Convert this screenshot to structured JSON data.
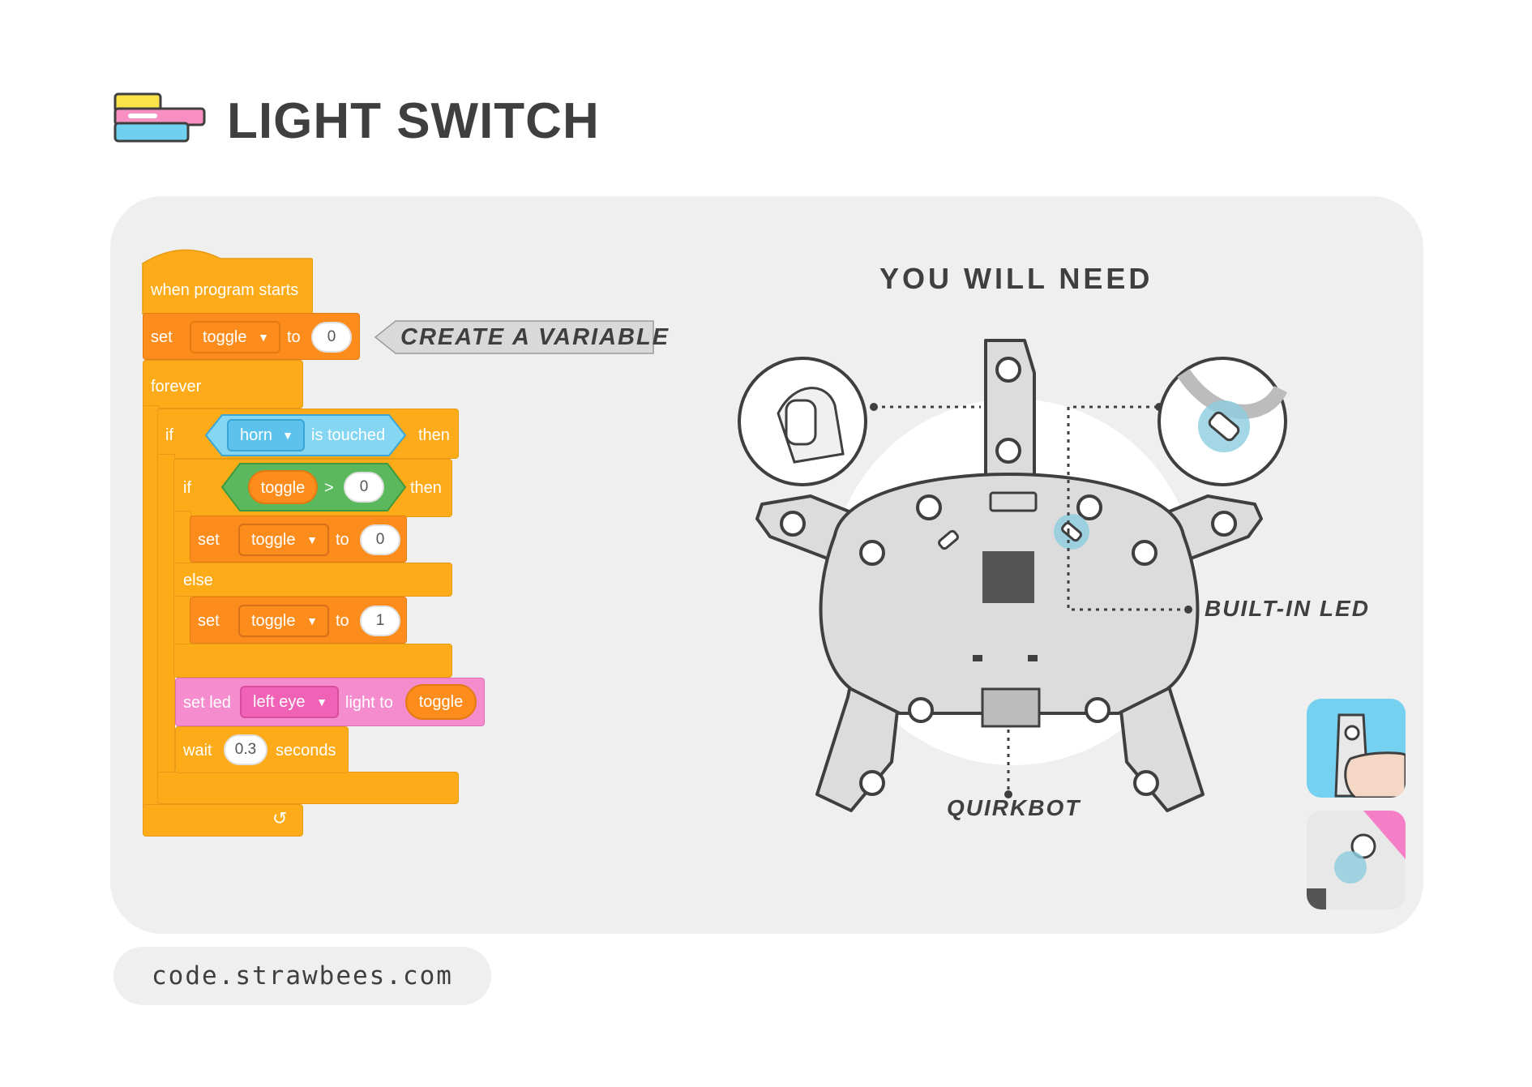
{
  "header": {
    "title": "LIGHT SWITCH",
    "logo_icon": "stacked-blocks-icon"
  },
  "code": {
    "hat": "when program starts",
    "set1": {
      "label": "set",
      "variable": "toggle",
      "to": "to",
      "value": "0"
    },
    "forever": "forever",
    "if1": {
      "if": "if",
      "sensor": "horn",
      "condition": "is touched",
      "then": "then"
    },
    "if2": {
      "if": "if",
      "variable": "toggle",
      "op": ">",
      "value": "0",
      "then": "then"
    },
    "set2": {
      "label": "set",
      "variable": "toggle",
      "to": "to",
      "value": "0"
    },
    "else": "else",
    "set3": {
      "label": "set",
      "variable": "toggle",
      "to": "to",
      "value": "1"
    },
    "setled": {
      "label": "set led",
      "led": "left eye",
      "light_to": "light to",
      "value": "toggle"
    },
    "wait": {
      "label": "wait",
      "value": "0.3",
      "unit": "seconds"
    },
    "loop_icon": "loop-arrow-icon"
  },
  "callout": {
    "create_variable": "CREATE A VARIABLE"
  },
  "need": {
    "title": "YOU WILL NEED",
    "built_in_led": "BUILT-IN LED",
    "quirkbot": "QUIRKBOT"
  },
  "footer": {
    "url": "code.strawbees.com"
  },
  "colors": {
    "panel": "#efefef",
    "events": "#fdab19",
    "variables": "#fc8d1d",
    "operators": "#5cb85c",
    "sensing": "#5ec3ec",
    "leds": "#f58ccd",
    "text_dark": "#3f3f3f"
  }
}
